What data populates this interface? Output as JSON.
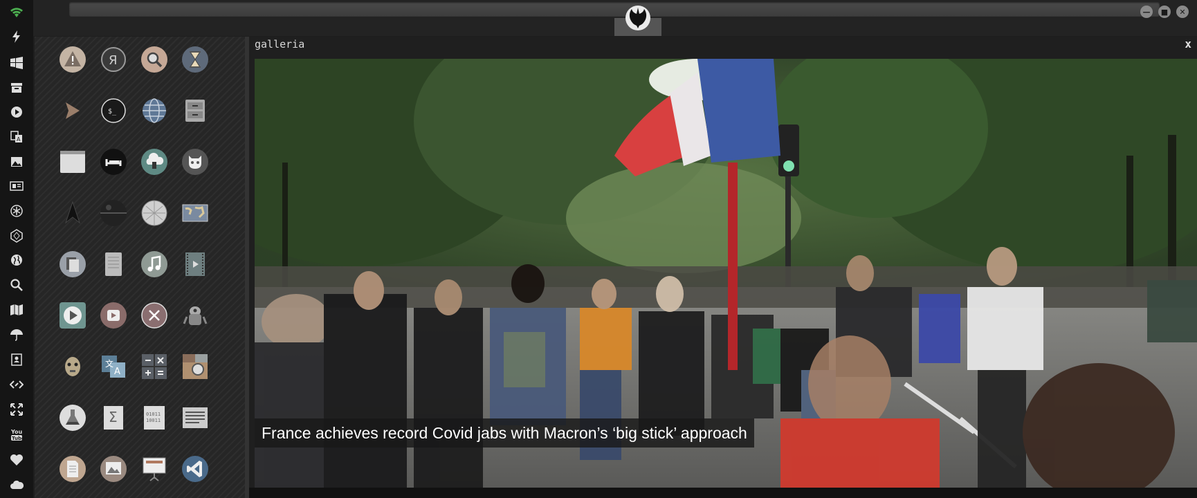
{
  "dock": {
    "items": [
      {
        "name": "wifi-icon",
        "color": "#4caf50"
      },
      {
        "name": "bolt-icon"
      },
      {
        "name": "windows-icon"
      },
      {
        "name": "archive-icon"
      },
      {
        "name": "play-circle-icon"
      },
      {
        "name": "translate-icon"
      },
      {
        "name": "image-icon"
      },
      {
        "name": "newspaper-icon"
      },
      {
        "name": "asterisk-icon"
      },
      {
        "name": "hexagon-icon"
      },
      {
        "name": "globe-icon"
      },
      {
        "name": "search-icon"
      },
      {
        "name": "map-icon"
      },
      {
        "name": "umbrella-icon"
      },
      {
        "name": "contacts-icon"
      },
      {
        "name": "code-icon"
      },
      {
        "name": "fullscreen-icon"
      },
      {
        "name": "youtube-icon"
      },
      {
        "name": "heart-icon"
      },
      {
        "name": "cloud-icon"
      }
    ]
  },
  "topbar": {
    "center_logo": "rebel-alliance-icon",
    "window_buttons": [
      {
        "name": "minimize-button",
        "glyph": "—"
      },
      {
        "name": "maximize-button",
        "glyph": "■"
      },
      {
        "name": "close-button",
        "glyph": "✕"
      }
    ]
  },
  "apps": [
    {
      "name": "warning-app-icon"
    },
    {
      "name": "yandex-app-icon"
    },
    {
      "name": "search-app-icon"
    },
    {
      "name": "hourglass-app-icon"
    },
    {
      "name": "arrow-app-icon"
    },
    {
      "name": "terminal-app-icon"
    },
    {
      "name": "globe-app-icon"
    },
    {
      "name": "file-cabinet-app-icon"
    },
    {
      "name": "window-app-icon"
    },
    {
      "name": "sleep-app-icon"
    },
    {
      "name": "cloud-lock-app-icon"
    },
    {
      "name": "github-app-icon"
    },
    {
      "name": "starfleet-app-icon"
    },
    {
      "name": "death-star-app-icon"
    },
    {
      "name": "wikipedia-app-icon"
    },
    {
      "name": "world-map-app-icon"
    },
    {
      "name": "documents-app-icon"
    },
    {
      "name": "notebook-app-icon"
    },
    {
      "name": "music-app-icon"
    },
    {
      "name": "film-app-icon"
    },
    {
      "name": "play-app-icon"
    },
    {
      "name": "video-app-icon"
    },
    {
      "name": "close-circle-app-icon"
    },
    {
      "name": "droid-app-icon"
    },
    {
      "name": "c3po-app-icon"
    },
    {
      "name": "translate-app-icon"
    },
    {
      "name": "calculator-app-icon"
    },
    {
      "name": "camera-app-icon"
    },
    {
      "name": "flask-app-icon"
    },
    {
      "name": "sigma-app-icon"
    },
    {
      "name": "binary-app-icon"
    },
    {
      "name": "text-editor-app-icon"
    },
    {
      "name": "document-app-icon"
    },
    {
      "name": "image-viewer-app-icon"
    },
    {
      "name": "presentation-app-icon"
    },
    {
      "name": "vscode-app-icon"
    }
  ],
  "gallery": {
    "title": "galleria",
    "close": "x",
    "caption": "France achieves record Covid jabs with Macron’s ‘big stick’ approach"
  }
}
